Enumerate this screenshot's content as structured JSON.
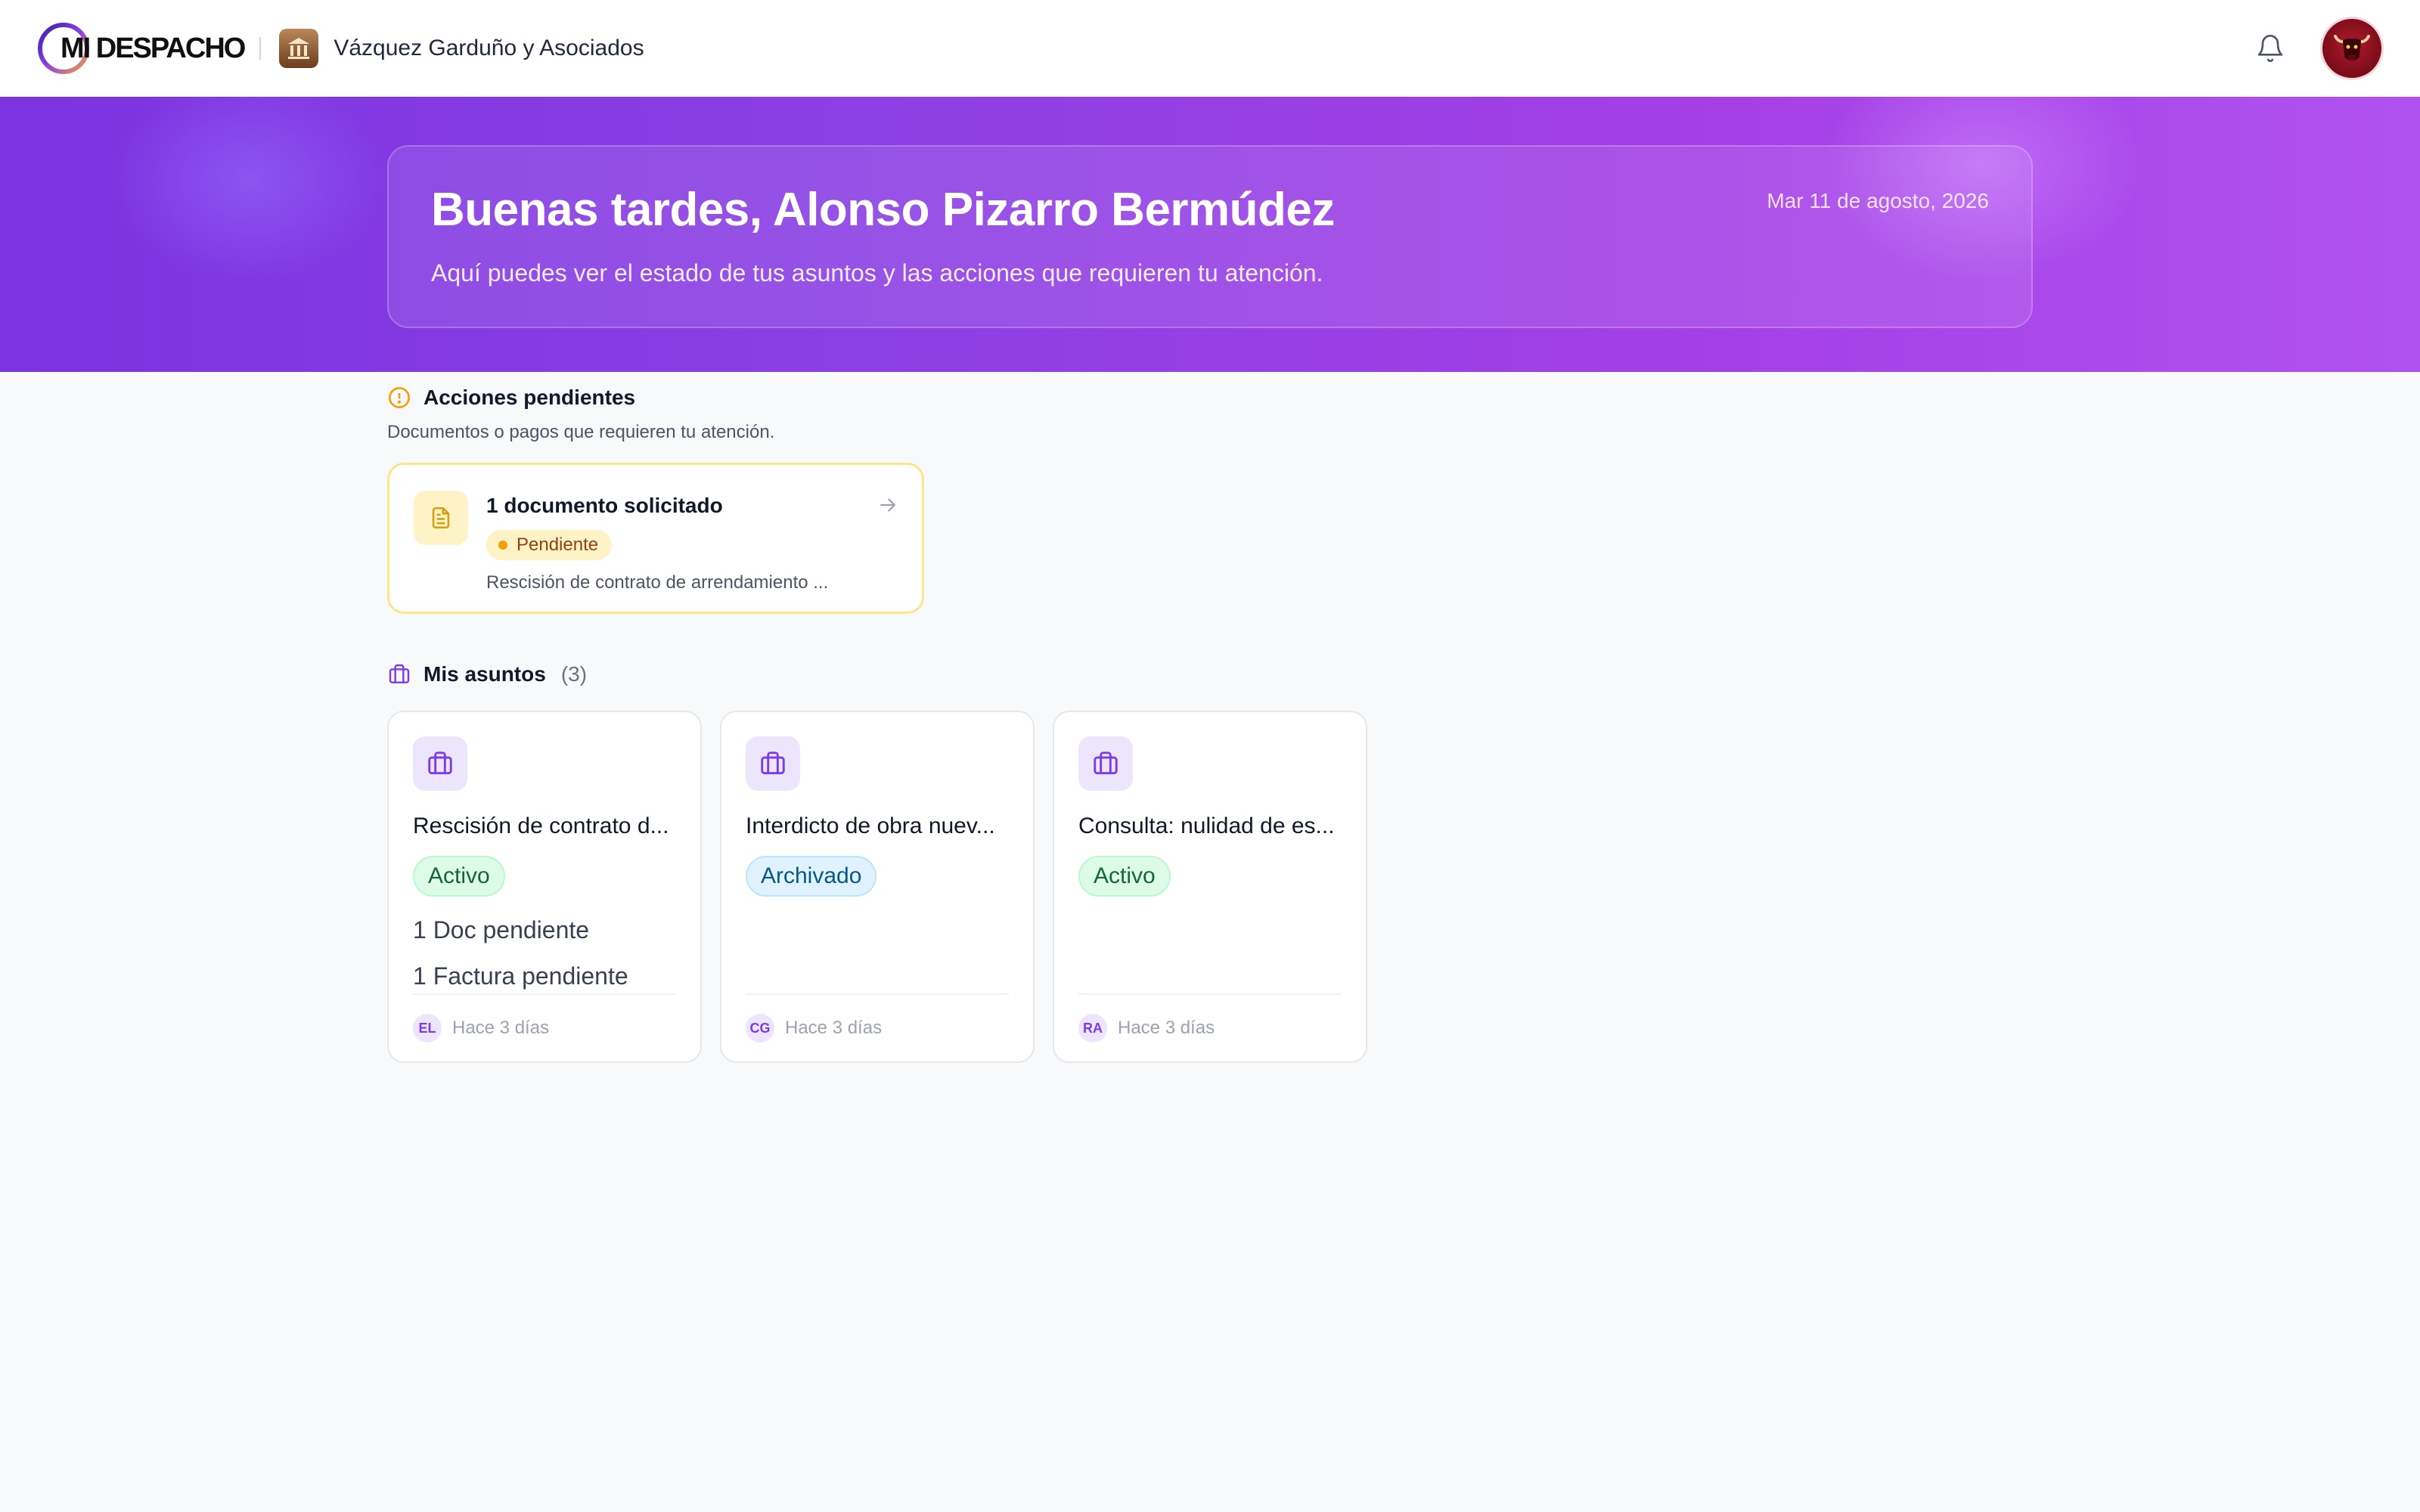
{
  "header": {
    "brand": "MI DESPACHO",
    "firm_name": "Vázquez Garduño y Asociados",
    "notifications_icon": "bell-icon",
    "avatar_icon": "bull-avatar"
  },
  "hero": {
    "greeting": "Buenas tardes, Alonso Pizarro Bermúdez",
    "subtitle": "Aquí puedes ver el estado de tus asuntos y las acciones que requieren tu atención.",
    "date": "Mar 11 de agosto, 2026"
  },
  "pending": {
    "title": "Acciones pendientes",
    "description": "Documentos o pagos que requieren tu atención.",
    "icon": "alert-circle-icon",
    "items": [
      {
        "title": "1 documento solicitado",
        "status": "Pendiente",
        "detail": "Rescisión de contrato de arrendamiento ...",
        "icon": "document-icon"
      }
    ]
  },
  "cases": {
    "title": "Mis asuntos",
    "count": "(3)",
    "icon": "briefcase-icon",
    "items": [
      {
        "title": "Rescisión de contrato d...",
        "status": "Activo",
        "meta": [
          "1 Doc pendiente",
          "1 Factura pendiente"
        ],
        "initials": "EL",
        "time": "Hace 3 días"
      },
      {
        "title": "Interdicto de obra nuev...",
        "status": "Archivado",
        "meta": [],
        "initials": "CG",
        "time": "Hace 3 días"
      },
      {
        "title": "Consulta: nulidad de es...",
        "status": "Activo",
        "meta": [],
        "initials": "RA",
        "time": "Hace 3 días"
      }
    ]
  },
  "colors": {
    "accent": "#7c3aed",
    "hero_start": "#7c33e0",
    "hero_end": "#b052f0",
    "pending_border": "#fde58a",
    "active_green": "#166534",
    "archived_blue": "#075985"
  }
}
